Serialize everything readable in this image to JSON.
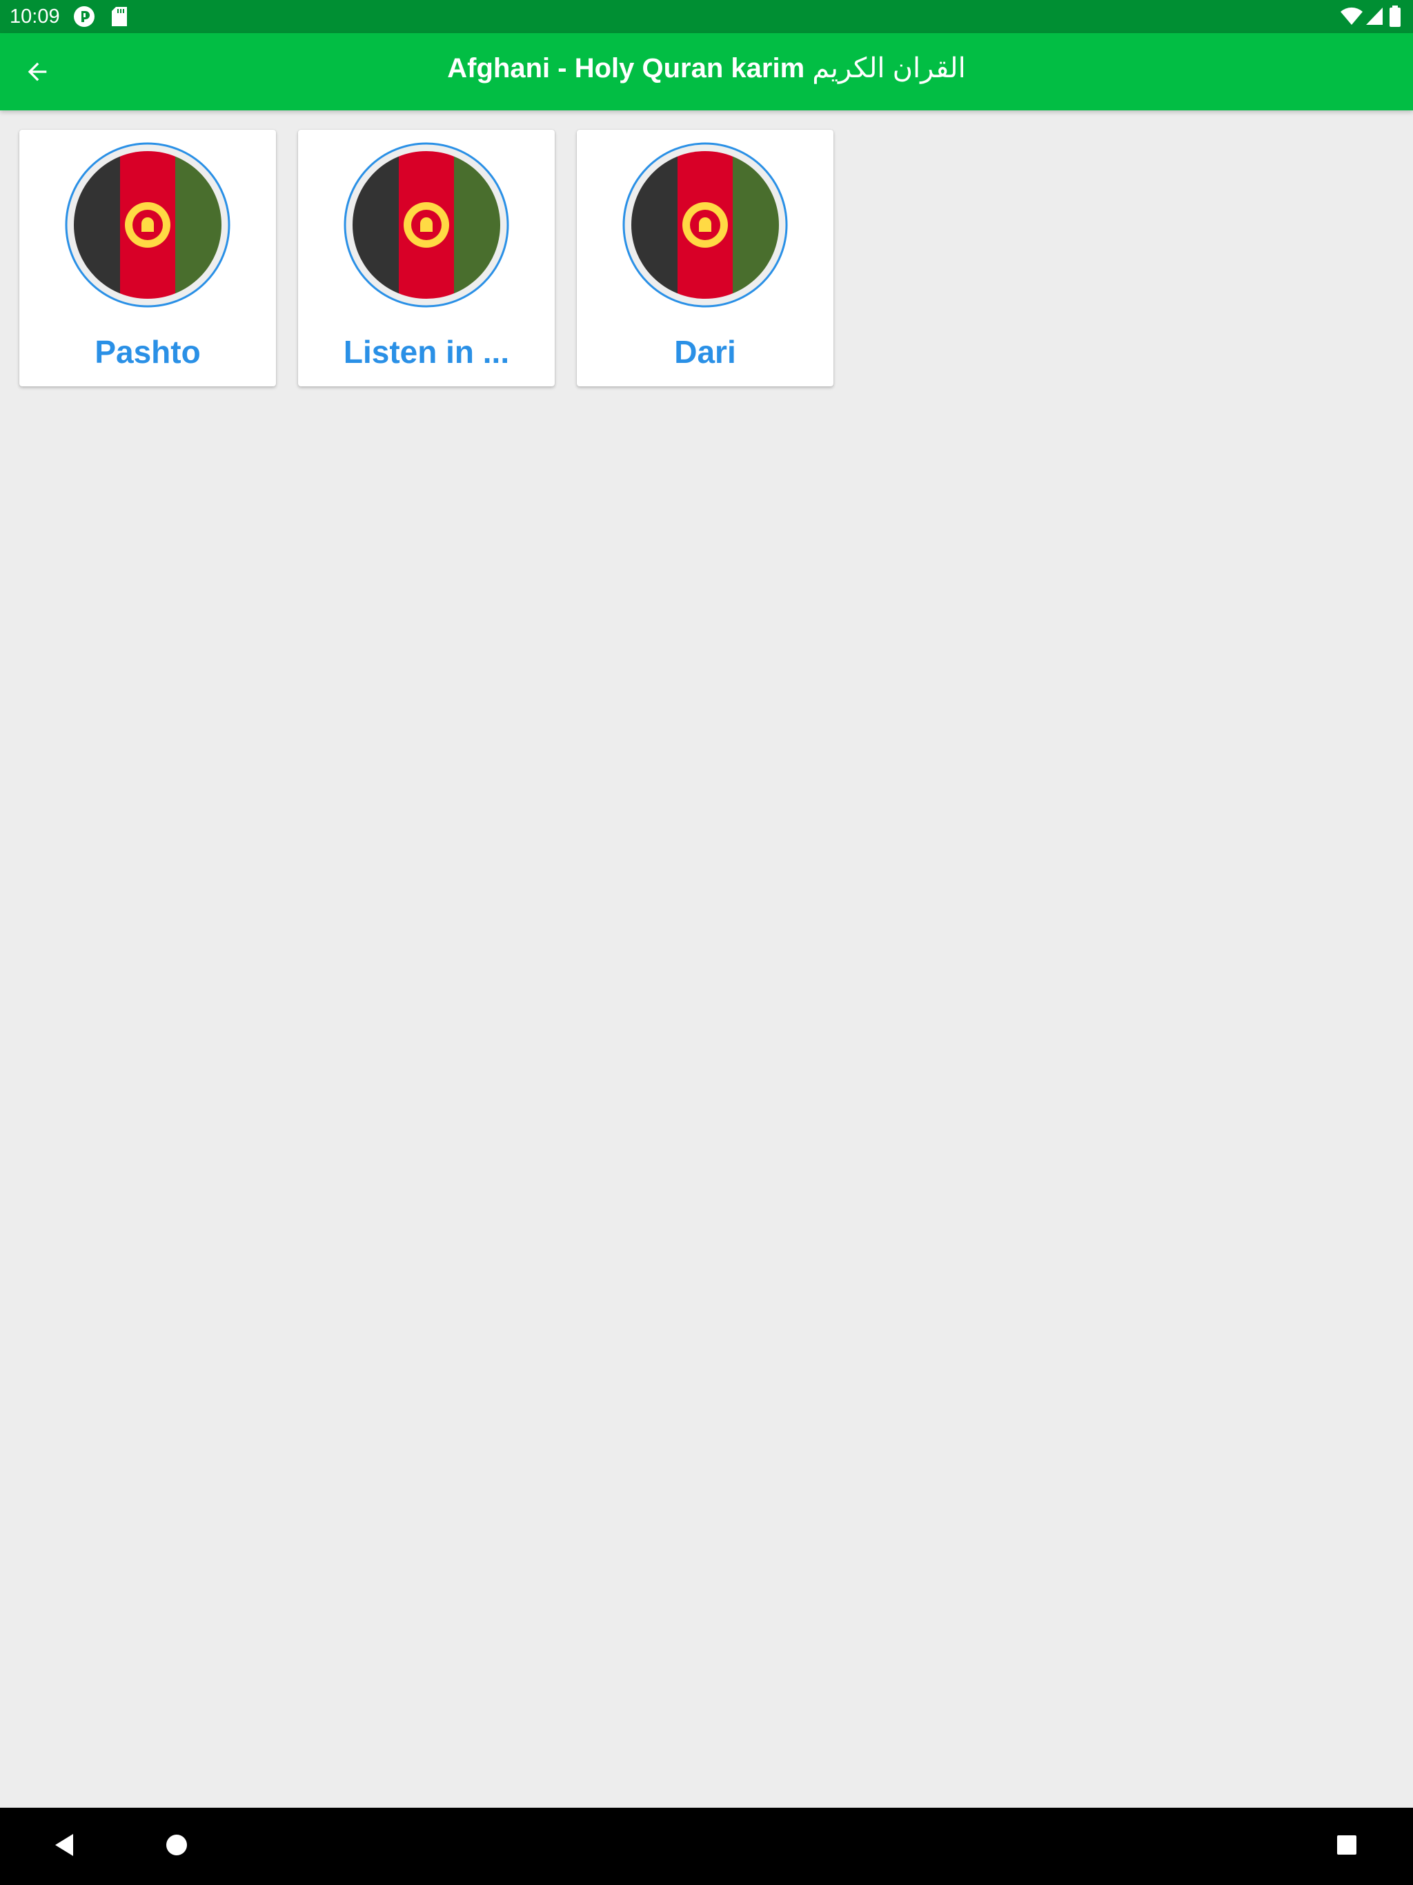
{
  "status_bar": {
    "time": "10:09",
    "left_icons": [
      "p-badge-icon",
      "sd-card-icon"
    ],
    "right_icons": [
      "wifi-icon",
      "signal-icon",
      "battery-icon"
    ]
  },
  "app_bar": {
    "title_latin": "Afghani - Holy Quran karim",
    "title_arabic": "القران الكريم",
    "back_icon": "arrow-back-icon"
  },
  "cards": [
    {
      "label": "Pashto",
      "icon": "afghanistan-flag-icon"
    },
    {
      "label": "Listen in ...",
      "icon": "afghanistan-flag-icon"
    },
    {
      "label": "Dari",
      "icon": "afghanistan-flag-icon"
    }
  ],
  "nav_bar": {
    "icons": [
      "nav-back-icon",
      "nav-home-icon",
      "nav-recents-icon"
    ]
  },
  "colors": {
    "status_bar": "#008f33",
    "app_bar": "#02be44",
    "background": "#ededed",
    "label": "#2a90e6",
    "flag_black": "#333333",
    "flag_red": "#d80027",
    "flag_green": "#496e2d",
    "flag_emblem": "#ffda44",
    "flag_ring": "#2a90e6"
  }
}
